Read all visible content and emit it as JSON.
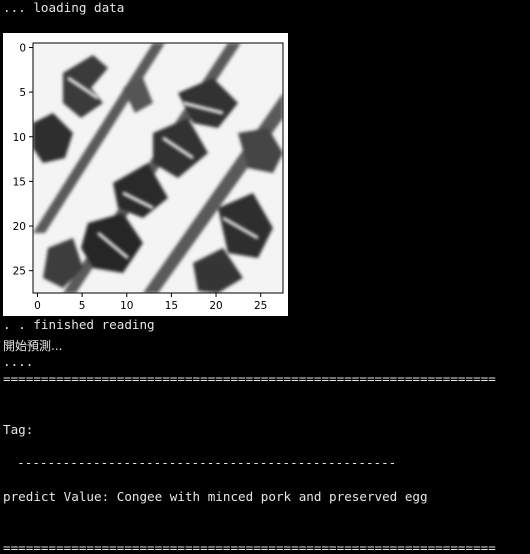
{
  "console": {
    "loading": "... loading data",
    "finished": ". . finished reading",
    "predict_start": "開始預測...",
    "dots": "....",
    "separator": "=================================================================",
    "tag_label": "Tag:",
    "dash_line": "  --------------------------------------------------",
    "predict_value": "predict Value: Congee with minced pork and preserved egg",
    "separator_bottom": "================================================================="
  },
  "figure": {
    "x_ticks": [
      "0",
      "5",
      "10",
      "15",
      "20",
      "25"
    ],
    "y_ticks": [
      "0",
      "5",
      "10",
      "15",
      "20",
      "25"
    ],
    "image_size": 28
  }
}
